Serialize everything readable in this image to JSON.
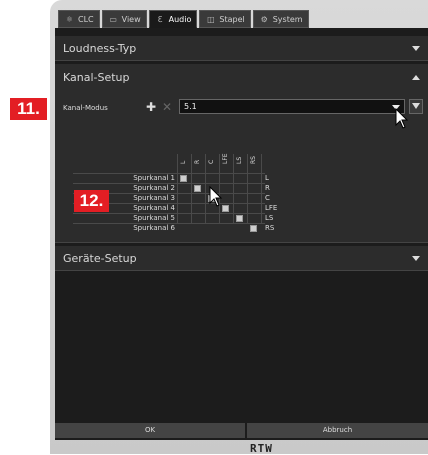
{
  "tabs": [
    {
      "label": "CLC",
      "icon": "clc-icon",
      "active": false
    },
    {
      "label": "View",
      "icon": "view-icon",
      "active": false
    },
    {
      "label": "Audio",
      "icon": "audio-icon",
      "active": true
    },
    {
      "label": "Stapel",
      "icon": "stapel-icon",
      "active": false
    },
    {
      "label": "System",
      "icon": "system-icon",
      "active": false
    }
  ],
  "sections": {
    "loudness": {
      "title": "Loudness-Typ"
    },
    "kanal": {
      "title": "Kanal-Setup"
    },
    "geraete": {
      "title": "Geräte-Setup"
    }
  },
  "kanal_modus": {
    "label": "Kanal-Modus",
    "value": "5.1"
  },
  "columns": [
    "L",
    "R",
    "C",
    "LFE",
    "LS",
    "RS"
  ],
  "rows": [
    {
      "label": "Spurkanal 1",
      "output": "L"
    },
    {
      "label": "Spurkanal 2",
      "output": "R"
    },
    {
      "label": "Spurkanal 3",
      "output": "C"
    },
    {
      "label": "Spurkanal 4",
      "output": "LFE"
    },
    {
      "label": "Spurkanal 5",
      "output": "LS"
    },
    {
      "label": "Spurkanal 6",
      "output": "RS"
    }
  ],
  "annotations": {
    "a11": "11.",
    "a12": "12."
  },
  "buttons": {
    "ok": "OK",
    "cancel": "Abbruch"
  },
  "logo": "RTW"
}
